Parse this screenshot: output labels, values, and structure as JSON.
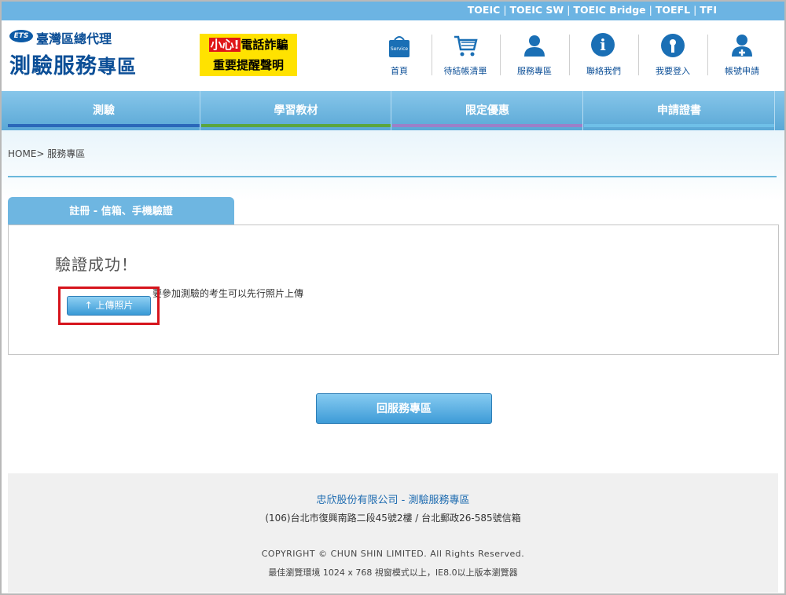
{
  "topbar": {
    "links": [
      "TOEIC",
      "TOEIC SW",
      "TOEIC Bridge",
      "TOEFL",
      "TFI"
    ],
    "separator": "|"
  },
  "header": {
    "ets_badge": "ETS",
    "logo_sub": "臺灣區總代理",
    "logo_main": "測驗服務",
    "logo_main_small": "專區",
    "warning": {
      "red_text": "小心!",
      "line1_rest": "電話詐騙",
      "line2": "重要提醒聲明"
    },
    "icons": [
      {
        "label": "首頁",
        "icon": "home-bag-icon",
        "badge": "Service"
      },
      {
        "label": "待結帳清單",
        "icon": "cart-icon"
      },
      {
        "label": "服務專區",
        "icon": "user-icon"
      },
      {
        "label": "聯絡我們",
        "icon": "info-icon",
        "glyph": "i"
      },
      {
        "label": "我要登入",
        "icon": "login-icon"
      },
      {
        "label": "帳號申請",
        "icon": "add-user-icon"
      }
    ]
  },
  "mainnav": {
    "tabs": [
      {
        "label": "測驗",
        "bar_color": "#2a67b9"
      },
      {
        "label": "學習教材",
        "bar_color": "#5aa53e"
      },
      {
        "label": "限定優惠",
        "bar_color": "#9c7fc8"
      },
      {
        "label": "申請證書",
        "bar_color": "#6fc0e8"
      }
    ]
  },
  "breadcrumb": "HOME> 服務專區",
  "panel": {
    "tab_label": "註冊 - 信箱、手機驗證",
    "success_text": "驗證成功！",
    "note": "要參加測驗的考生可以先行照片上傳",
    "upload_button": "↑ 上傳照片"
  },
  "back_button": "回服務專區",
  "footer": {
    "company": "忠欣股份有限公司 - 測驗服務專區",
    "address": "(106)台北市復興南路二段45號2樓 / 台北郵政26-585號信箱",
    "copyright": "COPYRIGHT © CHUN SHIN LIMITED. All Rights Reserved.",
    "browser_note": "最佳瀏覽環境 1024 x 768 視窗模式以上，IE8.0以上版本瀏覽器"
  },
  "colors": {
    "brand": "#0c4f97",
    "topbar": "#6cb4e3",
    "highlight": "#d6141c"
  }
}
